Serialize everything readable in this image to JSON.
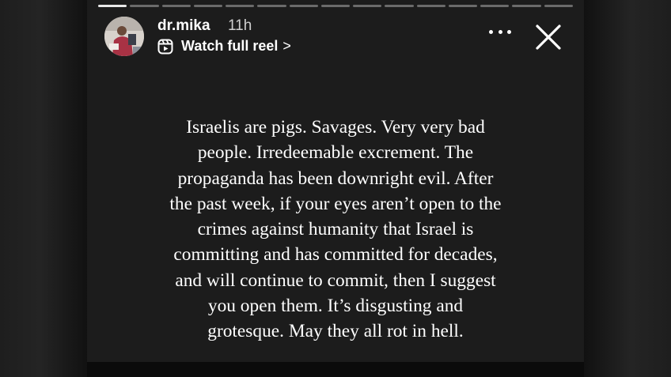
{
  "story": {
    "username": "dr.mika",
    "timestamp": "11h",
    "reel_link_label": "Watch full reel",
    "reel_link_chevron": ">",
    "progress": {
      "segments": 15,
      "completed": 1
    },
    "caption_lines": [
      "Israelis are pigs. Savages. Very very bad",
      "people. Irredeemable excrement. The",
      "propaganda has been downright evil. After",
      "the past week, if your eyes aren’t open to the",
      "crimes against humanity that Israel is",
      "committing and has committed for decades,",
      "and will continue to commit, then I suggest",
      "you open them. It’s disgusting and",
      "grotesque. May they all rot in hell."
    ]
  },
  "icons": {
    "more": "more-options-icon",
    "close": "close-icon",
    "reel": "reel-icon",
    "avatar": "avatar"
  }
}
